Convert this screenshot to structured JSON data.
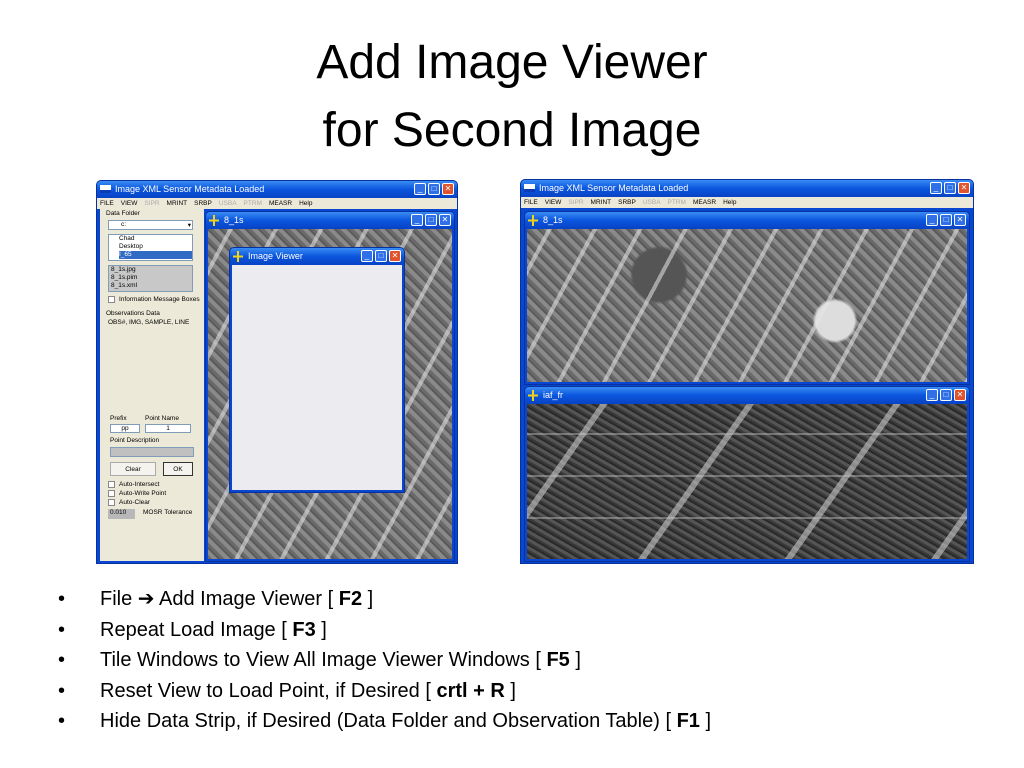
{
  "slide": {
    "title_line1": "Add Image Viewer",
    "title_line2": "for Second Image"
  },
  "app": {
    "title": "Image XML Sensor Metadata Loaded",
    "menu": [
      {
        "label": "FILE",
        "enabled": true
      },
      {
        "label": "VIEW",
        "enabled": true
      },
      {
        "label": "SIPR",
        "enabled": false
      },
      {
        "label": "MRINT",
        "enabled": true
      },
      {
        "label": "SRBP",
        "enabled": true
      },
      {
        "label": "USBA",
        "enabled": false
      },
      {
        "label": "PTRM",
        "enabled": false
      },
      {
        "label": "MEASR",
        "enabled": true
      },
      {
        "label": "Help",
        "enabled": true
      }
    ],
    "data_folder": {
      "label": "Data Folder",
      "drive": "c:",
      "folders": [
        "Chad",
        "Desktop",
        "I_65"
      ],
      "files": [
        "8_1s.jpg",
        "8_1s.pim",
        "8_1s.xml"
      ],
      "info_boxes": "Information Message Boxes"
    },
    "observations": {
      "label": "Observations Data",
      "header": "OBS#, IMG, SAMPLE, LINE"
    },
    "prefix_label": "Prefix",
    "prefix_value": "pp",
    "point_name_label": "Point Name",
    "point_name_value": "1",
    "point_desc_label": "Point Description",
    "clear": "Clear",
    "ok": "OK",
    "checks": [
      "Auto-Intersect",
      "Auto-Write Point",
      "Auto-Clear"
    ],
    "tolerance_value": "0.010",
    "tolerance_label": "MOSR Tolerance"
  },
  "windows": {
    "w1": "8_1s",
    "viewer": "Image Viewer",
    "w2": "iaf_fr"
  },
  "bullets": [
    {
      "pre": "File ➔ Add Image Viewer [ ",
      "key": "F2",
      "post": " ]"
    },
    {
      "pre": "Repeat Load Image [ ",
      "key": "F3",
      "post": " ]"
    },
    {
      "pre": "Tile Windows to View All Image Viewer Windows [ ",
      "key": "F5",
      "post": " ]"
    },
    {
      "pre": "Reset View to Load Point, if Desired [ ",
      "key": "crtl + R",
      "post": " ]"
    },
    {
      "pre": "Hide Data Strip, if Desired (Data Folder and Observation Table) [ ",
      "key": "F1",
      "post": " ]"
    }
  ]
}
